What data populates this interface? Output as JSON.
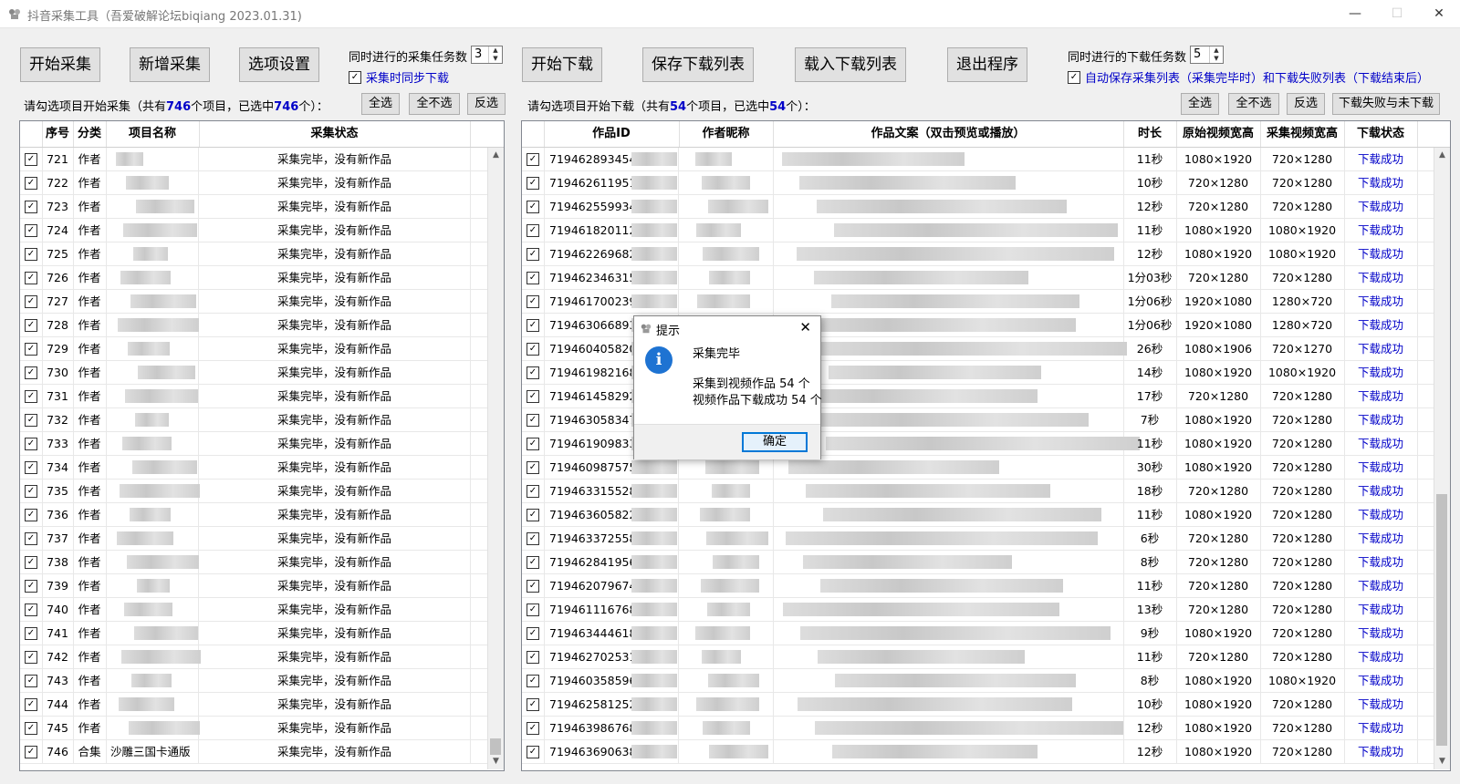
{
  "window": {
    "title": "抖音采集工具（吾爱破解论坛biqiang 2023.01.31)",
    "minimize_glyph": "—",
    "maximize_glyph": "☐",
    "close_glyph": "✕",
    "icon": "app-icon"
  },
  "toolbar": {
    "start_collect": "开始采集",
    "add_collect": "新增采集",
    "options": "选项设置",
    "collect_tasks_label": "同时进行的采集任务数",
    "collect_tasks_value": "3",
    "sync_download_label": "采集时同步下载",
    "start_download": "开始下载",
    "save_list": "保存下载列表",
    "load_list": "载入下载列表",
    "exit": "退出程序",
    "download_tasks_label": "同时进行的下载任务数",
    "download_tasks_value": "5",
    "autosave_label": "自动保存采集列表（采集完毕时）和下载失败列表（下载结束后）"
  },
  "left": {
    "prompt_prefix": "请勾选项目开始采集（共有",
    "total": "746",
    "prompt_mid": "个项目，已选中",
    "selected": "746",
    "prompt_suffix": "个）：",
    "select_all": "全选",
    "select_none": "全不选",
    "invert": "反选",
    "headers": {
      "seq": "序号",
      "cat": "分类",
      "name": "项目名称",
      "status": "采集状态"
    },
    "rows": [
      {
        "seq": "721",
        "cat": "作者",
        "name": "",
        "status": "采集完毕，没有新作品"
      },
      {
        "seq": "722",
        "cat": "作者",
        "name": "",
        "status": "采集完毕，没有新作品"
      },
      {
        "seq": "723",
        "cat": "作者",
        "name": "",
        "status": "采集完毕，没有新作品"
      },
      {
        "seq": "724",
        "cat": "作者",
        "name": "",
        "status": "采集完毕，没有新作品"
      },
      {
        "seq": "725",
        "cat": "作者",
        "name": "",
        "status": "采集完毕，没有新作品"
      },
      {
        "seq": "726",
        "cat": "作者",
        "name": "",
        "status": "采集完毕，没有新作品"
      },
      {
        "seq": "727",
        "cat": "作者",
        "name": "",
        "status": "采集完毕，没有新作品"
      },
      {
        "seq": "728",
        "cat": "作者",
        "name": "",
        "status": "采集完毕，没有新作品"
      },
      {
        "seq": "729",
        "cat": "作者",
        "name": "",
        "status": "采集完毕，没有新作品"
      },
      {
        "seq": "730",
        "cat": "作者",
        "name": "",
        "status": "采集完毕，没有新作品"
      },
      {
        "seq": "731",
        "cat": "作者",
        "name": "",
        "status": "采集完毕，没有新作品"
      },
      {
        "seq": "732",
        "cat": "作者",
        "name": "",
        "status": "采集完毕，没有新作品"
      },
      {
        "seq": "733",
        "cat": "作者",
        "name": "",
        "status": "采集完毕，没有新作品"
      },
      {
        "seq": "734",
        "cat": "作者",
        "name": "",
        "status": "采集完毕，没有新作品"
      },
      {
        "seq": "735",
        "cat": "作者",
        "name": "",
        "status": "采集完毕，没有新作品"
      },
      {
        "seq": "736",
        "cat": "作者",
        "name": "",
        "status": "采集完毕，没有新作品"
      },
      {
        "seq": "737",
        "cat": "作者",
        "name": "",
        "status": "采集完毕，没有新作品"
      },
      {
        "seq": "738",
        "cat": "作者",
        "name": "",
        "status": "采集完毕，没有新作品"
      },
      {
        "seq": "739",
        "cat": "作者",
        "name": "",
        "status": "采集完毕，没有新作品"
      },
      {
        "seq": "740",
        "cat": "作者",
        "name": "",
        "status": "采集完毕，没有新作品"
      },
      {
        "seq": "741",
        "cat": "作者",
        "name": "",
        "status": "采集完毕，没有新作品"
      },
      {
        "seq": "742",
        "cat": "作者",
        "name": "",
        "status": "采集完毕，没有新作品"
      },
      {
        "seq": "743",
        "cat": "作者",
        "name": "",
        "status": "采集完毕，没有新作品"
      },
      {
        "seq": "744",
        "cat": "作者",
        "name": "",
        "status": "采集完毕，没有新作品"
      },
      {
        "seq": "745",
        "cat": "作者",
        "name": "",
        "status": "采集完毕，没有新作品"
      },
      {
        "seq": "746",
        "cat": "合集",
        "name": "沙雕三国卡通版",
        "status": "采集完毕，没有新作品"
      }
    ]
  },
  "right": {
    "prompt_prefix": "请勾选项目开始下载（共有",
    "total": "54",
    "prompt_mid": "个项目，已选中",
    "selected": "54",
    "prompt_suffix": "个）：",
    "select_all": "全选",
    "select_none": "全不选",
    "invert": "反选",
    "fail_download": "下载失败与未下载",
    "headers": {
      "id": "作品ID",
      "author": "作者昵称",
      "caption": "作品文案（双击预览或播放）",
      "duration": "时长",
      "orig": "原始视频宽高",
      "coll": "采集视频宽高",
      "status": "下载状态"
    },
    "rows": [
      {
        "id": "719462893454",
        "duration": "11秒",
        "orig": "1080×1920",
        "coll": "720×1280",
        "status": "下载成功"
      },
      {
        "id": "719462611951",
        "duration": "10秒",
        "orig": "720×1280",
        "coll": "720×1280",
        "status": "下载成功"
      },
      {
        "id": "719462559934",
        "duration": "12秒",
        "orig": "720×1280",
        "coll": "720×1280",
        "status": "下载成功"
      },
      {
        "id": "719461820112",
        "duration": "11秒",
        "orig": "1080×1920",
        "coll": "1080×1920",
        "status": "下载成功"
      },
      {
        "id": "719462269682",
        "duration": "12秒",
        "orig": "1080×1920",
        "coll": "1080×1920",
        "status": "下载成功"
      },
      {
        "id": "719462346315",
        "duration": "1分03秒",
        "orig": "720×1280",
        "coll": "720×1280",
        "status": "下载成功"
      },
      {
        "id": "719461700239",
        "duration": "1分06秒",
        "orig": "1920×1080",
        "coll": "1280×720",
        "status": "下载成功"
      },
      {
        "id": "719463066893",
        "duration": "1分06秒",
        "orig": "1920×1080",
        "coll": "1280×720",
        "status": "下载成功"
      },
      {
        "id": "719460405820",
        "duration": "26秒",
        "orig": "1080×1906",
        "coll": "720×1270",
        "status": "下载成功"
      },
      {
        "id": "719461982168",
        "duration": "14秒",
        "orig": "1080×1920",
        "coll": "1080×1920",
        "status": "下载成功"
      },
      {
        "id": "719461458292",
        "duration": "17秒",
        "orig": "720×1280",
        "coll": "720×1280",
        "status": "下载成功"
      },
      {
        "id": "719463058347",
        "duration": "7秒",
        "orig": "1080×1920",
        "coll": "720×1280",
        "status": "下载成功"
      },
      {
        "id": "719461909833",
        "duration": "11秒",
        "orig": "1080×1920",
        "coll": "720×1280",
        "status": "下载成功"
      },
      {
        "id": "719460987575",
        "duration": "30秒",
        "orig": "1080×1920",
        "coll": "720×1280",
        "status": "下载成功"
      },
      {
        "id": "719463315528",
        "duration": "18秒",
        "orig": "720×1280",
        "coll": "720×1280",
        "status": "下载成功"
      },
      {
        "id": "719463605822",
        "duration": "11秒",
        "orig": "1080×1920",
        "coll": "720×1280",
        "status": "下载成功"
      },
      {
        "id": "719463372558",
        "duration": "6秒",
        "orig": "720×1280",
        "coll": "720×1280",
        "status": "下载成功"
      },
      {
        "id": "719462841956",
        "duration": "8秒",
        "orig": "720×1280",
        "coll": "720×1280",
        "status": "下载成功"
      },
      {
        "id": "719462079674",
        "duration": "11秒",
        "orig": "720×1280",
        "coll": "720×1280",
        "status": "下载成功"
      },
      {
        "id": "719461116768",
        "duration": "13秒",
        "orig": "720×1280",
        "coll": "720×1280",
        "status": "下载成功"
      },
      {
        "id": "719463444618",
        "duration": "9秒",
        "orig": "1080×1920",
        "coll": "720×1280",
        "status": "下载成功"
      },
      {
        "id": "719462702531",
        "duration": "11秒",
        "orig": "720×1280",
        "coll": "720×1280",
        "status": "下载成功"
      },
      {
        "id": "719460358596",
        "duration": "8秒",
        "orig": "1080×1920",
        "coll": "1080×1920",
        "status": "下载成功"
      },
      {
        "id": "719462581252",
        "duration": "10秒",
        "orig": "1080×1920",
        "coll": "720×1280",
        "status": "下载成功"
      },
      {
        "id": "719463986768",
        "duration": "12秒",
        "orig": "1080×1920",
        "coll": "720×1280",
        "status": "下载成功"
      },
      {
        "id": "719463690638",
        "duration": "12秒",
        "orig": "1080×1920",
        "coll": "720×1280",
        "status": "下载成功"
      }
    ]
  },
  "dialog": {
    "title": "提示",
    "heading": "采集完毕",
    "line1": "采集到视频作品 54 个",
    "line2": "视频作品下载成功 54 个",
    "ok": "确定",
    "icon": "info-icon",
    "icon_glyph": "i",
    "close_glyph": "✕"
  },
  "check_glyph": "✓",
  "colors": {
    "accent": "#0000c8",
    "info": "#1e73d2"
  }
}
